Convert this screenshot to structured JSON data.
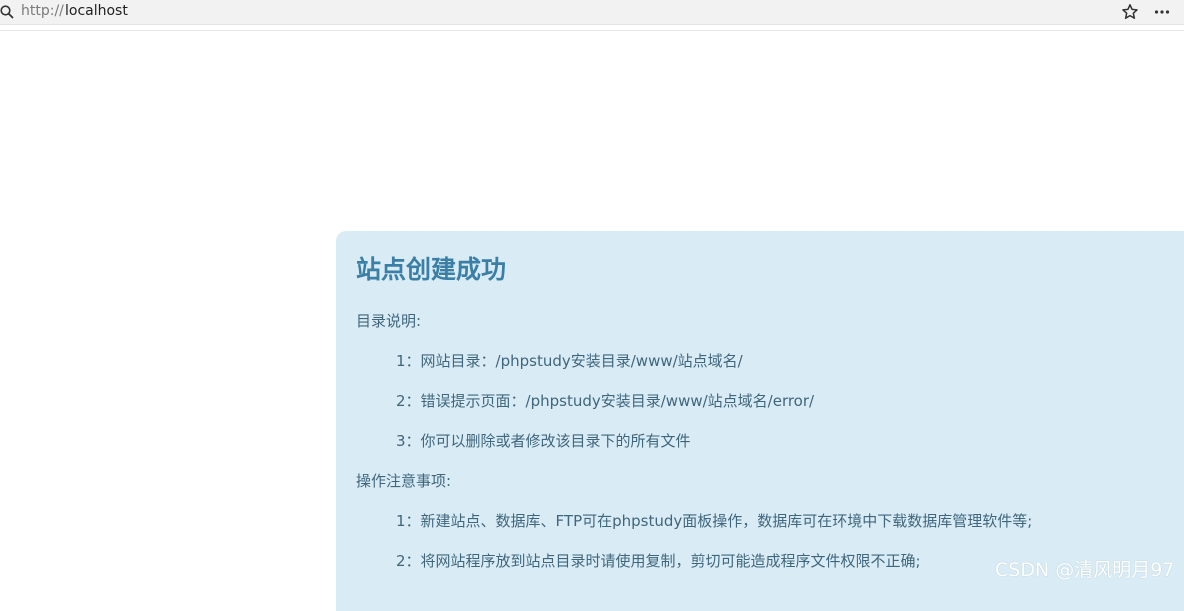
{
  "browser": {
    "url_scheme": "http://",
    "url_host": "localhost",
    "icons": [
      "search-icon",
      "star-icon",
      "more-icon"
    ]
  },
  "page": {
    "title": "站点创建成功",
    "directory_heading": "目录说明:",
    "directory_items": [
      "1：网站目录：/phpstudy安装目录/www/站点域名/",
      "2：错误提示页面：/phpstudy安装目录/www/站点域名/error/",
      "3：你可以删除或者修改该目录下的所有文件"
    ],
    "notes_heading": "操作注意事项:",
    "notes_items": [
      "1：新建站点、数据库、FTP可在phpstudy面板操作，数据库可在环境中下载数据库管理软件等;",
      "2：将网站程序放到站点目录时请使用复制，剪切可能造成程序文件权限不正确;"
    ]
  },
  "watermark": "CSDN @清风明月97",
  "colors": {
    "panel_bg": "#d9ecf5",
    "title": "#3b7fa6",
    "text": "#40667d",
    "toolbar_bg": "#f2f2f2"
  }
}
